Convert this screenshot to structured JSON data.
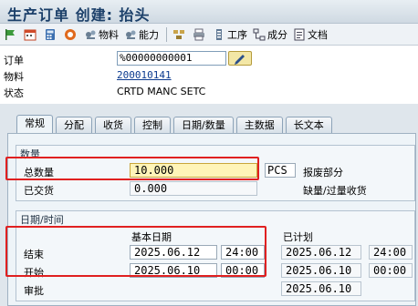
{
  "title": "生产订单 创建: 抬头",
  "toolbar": {
    "material_label": "物料",
    "capacity_label": "能力",
    "operation_label": "工序",
    "component_label": "成分",
    "document_label": "文档"
  },
  "header": {
    "order_label": "订单",
    "order_value": "%00000000001",
    "material_label": "物料",
    "material_value": "200010141",
    "status_label": "状态",
    "status_value": "CRTD MANC SETC"
  },
  "tabs": [
    "常规",
    "分配",
    "收货",
    "控制",
    "日期/数量",
    "主数据",
    "长文本"
  ],
  "quantity": {
    "group_title": "数量",
    "total_label": "总数量",
    "total_value": "10.000",
    "unit": "PCS",
    "scrap_label": "报废部分",
    "delivered_label": "已交货",
    "delivered_value": "0.000",
    "shortage_label": "缺量/过量收货"
  },
  "dates": {
    "group_title": "日期/时间",
    "basic_header": "基本日期",
    "scheduled_header": "已计划",
    "end_label": "结束",
    "end_basic_date": "2025.06.12",
    "end_basic_time": "24:00",
    "end_sched_date": "2025.06.12",
    "end_sched_time": "24:00",
    "start_label": "开始",
    "start_basic_date": "2025.06.10",
    "start_basic_time": "00:00",
    "start_sched_date": "2025.06.10",
    "start_sched_time": "00:00",
    "release_label": "审批",
    "release_sched_date": "2025.06.10"
  },
  "colors": {
    "highlight": "#e02020",
    "required_field": "#fff4b8"
  }
}
